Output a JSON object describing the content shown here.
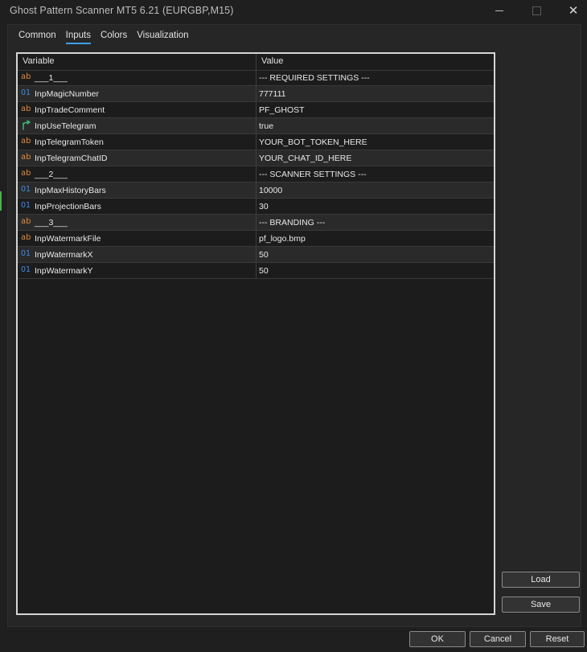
{
  "window": {
    "title": "Ghost Pattern Scanner MT5 6.21 (EURGBP,M15)",
    "close_glyph": "✕"
  },
  "tabs": [
    {
      "label": "Common"
    },
    {
      "label": "Inputs",
      "active": true
    },
    {
      "label": "Colors"
    },
    {
      "label": "Visualization"
    }
  ],
  "table": {
    "headers": {
      "variable": "Variable",
      "value": "Value"
    },
    "rows": [
      {
        "icon": "ab",
        "type_icon": "string-type-icon",
        "variable": "___1___",
        "value": "--- REQUIRED SETTINGS ---"
      },
      {
        "icon": "01",
        "type_icon": "number-type-icon",
        "variable": "InpMagicNumber",
        "value": "777111"
      },
      {
        "icon": "ab",
        "type_icon": "string-type-icon",
        "variable": "InpTradeComment",
        "value": "PF_GHOST"
      },
      {
        "icon": "",
        "type_icon": "bool-type-icon",
        "variable": "InpUseTelegram",
        "value": "true"
      },
      {
        "icon": "ab",
        "type_icon": "string-type-icon",
        "variable": "InpTelegramToken",
        "value": "YOUR_BOT_TOKEN_HERE"
      },
      {
        "icon": "ab",
        "type_icon": "string-type-icon",
        "variable": "InpTelegramChatID",
        "value": "YOUR_CHAT_ID_HERE"
      },
      {
        "icon": "ab",
        "type_icon": "string-type-icon",
        "variable": "___2___",
        "value": "--- SCANNER SETTINGS ---"
      },
      {
        "icon": "01",
        "type_icon": "number-type-icon",
        "variable": "InpMaxHistoryBars",
        "value": "10000"
      },
      {
        "icon": "01",
        "type_icon": "number-type-icon",
        "variable": "InpProjectionBars",
        "value": "30"
      },
      {
        "icon": "ab",
        "type_icon": "string-type-icon",
        "variable": "___3___",
        "value": "--- BRANDING ---"
      },
      {
        "icon": "ab",
        "type_icon": "string-type-icon",
        "variable": "InpWatermarkFile",
        "value": "pf_logo.bmp"
      },
      {
        "icon": "01",
        "type_icon": "number-type-icon",
        "variable": "InpWatermarkX",
        "value": "50"
      },
      {
        "icon": "01",
        "type_icon": "number-type-icon",
        "variable": "InpWatermarkY",
        "value": "50"
      }
    ]
  },
  "buttons": {
    "load": "Load",
    "save": "Save",
    "ok": "OK",
    "cancel": "Cancel",
    "reset": "Reset"
  },
  "colors": {
    "accent": "#3aa0e8",
    "string_icon": "#e08a3c",
    "number_icon": "#3a8ee6",
    "bool_icon": "#3cb371"
  }
}
